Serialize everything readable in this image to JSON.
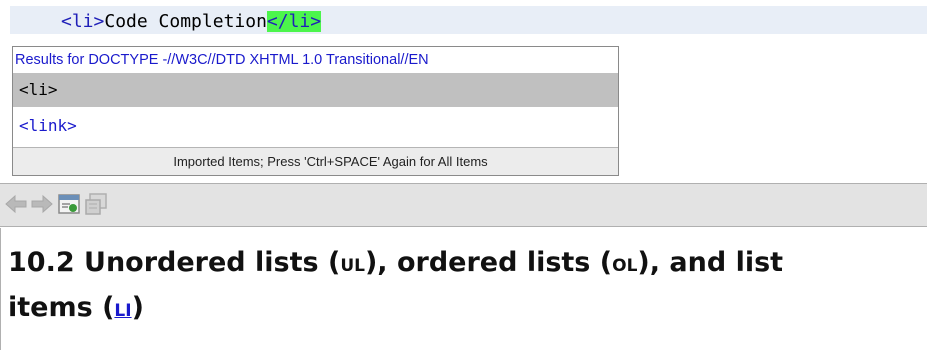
{
  "editor": {
    "open_tag": "<li>",
    "content": "Code Completion",
    "close_tag": "</li>"
  },
  "popup": {
    "header": "Results for DOCTYPE -//W3C//DTD XHTML 1.0 Transitional//EN",
    "items": [
      {
        "label": "<li>",
        "selected": true
      },
      {
        "label": "<link>",
        "selected": false
      }
    ],
    "footer": "Imported Items; Press 'Ctrl+SPACE' Again for All Items"
  },
  "toolbar": {
    "icons": [
      "back-arrow-icon",
      "forward-arrow-icon",
      "open-in-browser-icon",
      "show-source-icon"
    ]
  },
  "doc": {
    "heading_prefix": "10.2 Unordered lists (",
    "ul": "UL",
    "mid1": "), ordered lists (",
    "ol": "OL",
    "mid2": "), and list",
    "items_word": "items (",
    "li": "LI",
    "suffix": ")"
  },
  "colors": {
    "tag": "#1f1fb8",
    "highlight": "#4cf54c",
    "selection": "#c0c0c0",
    "link": "#1a1acc"
  }
}
